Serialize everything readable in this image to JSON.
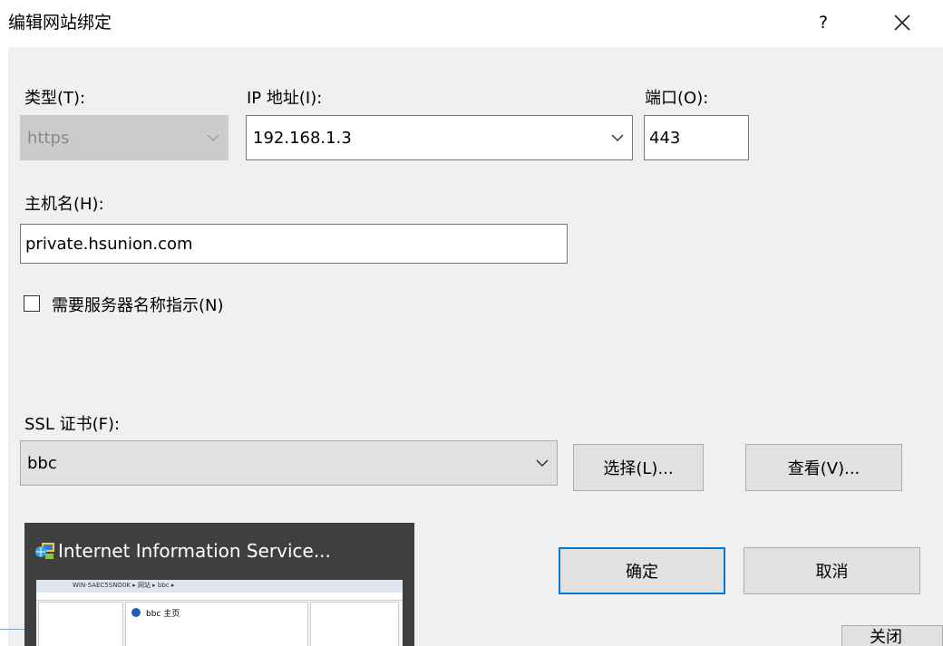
{
  "dialog": {
    "title": "编辑网站绑定",
    "help_label": "?"
  },
  "form": {
    "type_label": "类型(T):",
    "type_value": "https",
    "ip_label": "IP 地址(I):",
    "ip_value": "192.168.1.3",
    "port_label": "端口(O):",
    "port_value": "443",
    "hostname_label": "主机名(H):",
    "hostname_value": "private.hsunion.com",
    "sni_label": "需要服务器名称指示(N)",
    "sni_checked": false,
    "ssl_label": "SSL 证书(F):",
    "ssl_value": "bbc",
    "select_button": "选择(L)...",
    "view_button": "查看(V)..."
  },
  "buttons": {
    "ok": "确定",
    "cancel": "取消",
    "close_partial": "关闭"
  },
  "taskbar_thumbnail": {
    "title": "Internet Information Service...",
    "preview_address": "WIN-5AEC5SNO0K ▸ 网站 ▸ bbc ▸",
    "preview_page_title": "bbc 主页"
  },
  "colors": {
    "dialog_bg": "#f0f0f0",
    "default_button_border": "#0078d7",
    "thumbnail_bg": "#3f3f3f"
  }
}
